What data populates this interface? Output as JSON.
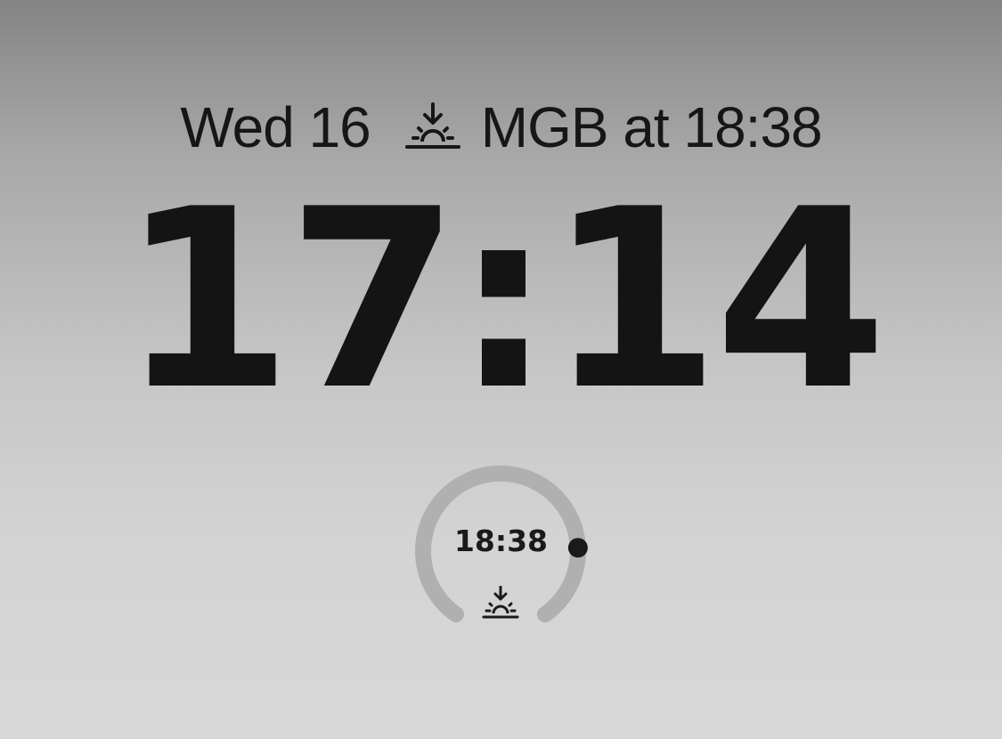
{
  "lock_screen": {
    "date_line": {
      "date": "Wed 16",
      "event_icon": "sunset-icon",
      "event_text": "MGB at 18:38"
    },
    "clock": {
      "time": "17:14"
    },
    "widget": {
      "time": "18:38",
      "icon": "sunset-icon",
      "progress_fraction": 0.82
    }
  },
  "colors": {
    "text": "#161616",
    "ring_track": "#b0b0b0",
    "ring_indicator": "#1a1a1a"
  }
}
